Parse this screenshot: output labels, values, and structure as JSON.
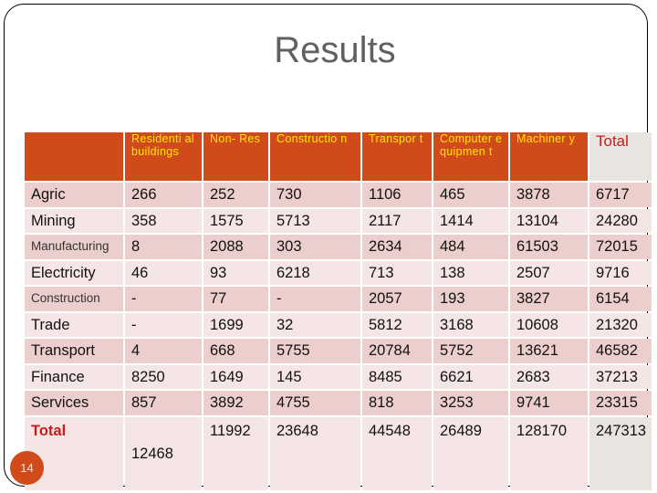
{
  "slide": {
    "title": "Results",
    "page_number": "14"
  },
  "table": {
    "headers": [
      "",
      "Residential buildings",
      "Non-Res",
      "Construction",
      "Transport",
      "Computer equipment",
      "Machinery",
      "Total"
    ],
    "header_display": [
      "",
      "Residenti al buildings",
      "Non- Res",
      "Constructio n",
      "Transpor t",
      "Computer equipmen t",
      "Machiner y",
      "Total"
    ],
    "rows": [
      {
        "label": "Agric",
        "values": [
          "266",
          "252",
          "730",
          "1106",
          "465",
          "3878",
          "6717"
        ]
      },
      {
        "label": "Mining",
        "values": [
          "358",
          "1575",
          "5713",
          "2117",
          "1414",
          "13104",
          "24280"
        ]
      },
      {
        "label": "Manufacturing",
        "values": [
          "8",
          "2088",
          "303",
          "2634",
          "484",
          "61503",
          "72015"
        ]
      },
      {
        "label": "Electricity",
        "values": [
          "46",
          "93",
          "6218",
          "713",
          "138",
          "2507",
          "9716"
        ]
      },
      {
        "label": "Construction",
        "values": [
          "-",
          "77",
          "-",
          "2057",
          "193",
          "3827",
          "6154"
        ]
      },
      {
        "label": "Trade",
        "values": [
          "-",
          "1699",
          "32",
          "5812",
          "3168",
          "10608",
          "21320"
        ]
      },
      {
        "label": "Transport",
        "values": [
          "4",
          "668",
          "5755",
          "20784",
          "5752",
          "13621",
          "46582"
        ]
      },
      {
        "label": "Finance",
        "values": [
          "8250",
          "1649",
          "145",
          "8485",
          "6621",
          "2683",
          "37213"
        ]
      },
      {
        "label": "Services",
        "values": [
          "857",
          "3892",
          "4755",
          "818",
          "3253",
          "9741",
          "23315"
        ]
      }
    ],
    "total_row": {
      "label": "Total",
      "values": [
        "12468",
        "11992",
        "23648",
        "44548",
        "26489",
        "128170",
        "247313"
      ]
    }
  },
  "colors": {
    "header_bg": "#d14a1a",
    "header_text": "#ffe600",
    "total_text": "#cc1a1a",
    "row_odd": "#eccfcd",
    "row_even": "#f5e5e4",
    "total_col_header_bg": "#e8e4e0"
  }
}
